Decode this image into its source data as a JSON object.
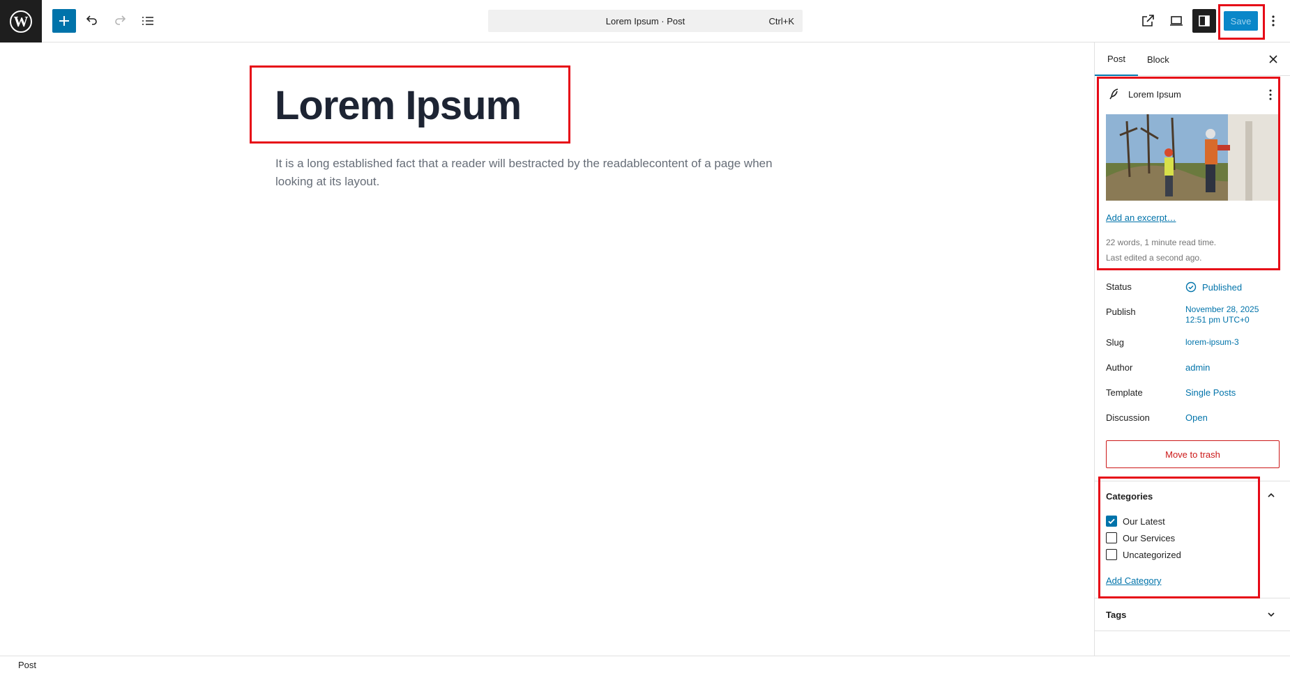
{
  "toolbar": {
    "document_title": "Lorem Ipsum · Post",
    "shortcut": "Ctrl+K",
    "save_label": "Save"
  },
  "editor": {
    "title": "Lorem Ipsum",
    "body": "It is a long established fact that a reader will bestracted by the readablecontent of a page when looking at its layout."
  },
  "sidebar": {
    "tabs": [
      {
        "label": "Post",
        "active": true
      },
      {
        "label": "Block",
        "active": false
      }
    ],
    "post_card": {
      "title": "Lorem Ipsum",
      "excerpt_link": "Add an excerpt…",
      "word_count": "22 words, 1 minute read time.",
      "last_edited": "Last edited a second ago."
    },
    "rows": [
      {
        "label": "Status",
        "value": "Published"
      },
      {
        "label": "Publish",
        "value_line1": "November 28, 2025",
        "value_line2": "12:51 pm UTC+0"
      },
      {
        "label": "Slug",
        "value": "lorem-ipsum-3"
      },
      {
        "label": "Author",
        "value": "admin"
      },
      {
        "label": "Template",
        "value": "Single Posts"
      },
      {
        "label": "Discussion",
        "value": "Open"
      }
    ],
    "trash_label": "Move to trash",
    "categories": {
      "title": "Categories",
      "items": [
        {
          "label": "Our Latest",
          "checked": true
        },
        {
          "label": "Our Services",
          "checked": false
        },
        {
          "label": "Uncategorized",
          "checked": false
        }
      ],
      "add_label": "Add Category"
    },
    "tags_title": "Tags"
  },
  "footer": {
    "breadcrumb": "Post"
  },
  "colors": {
    "accent": "#0073aa",
    "danger": "#cc1818",
    "highlight": "#e60a17"
  }
}
